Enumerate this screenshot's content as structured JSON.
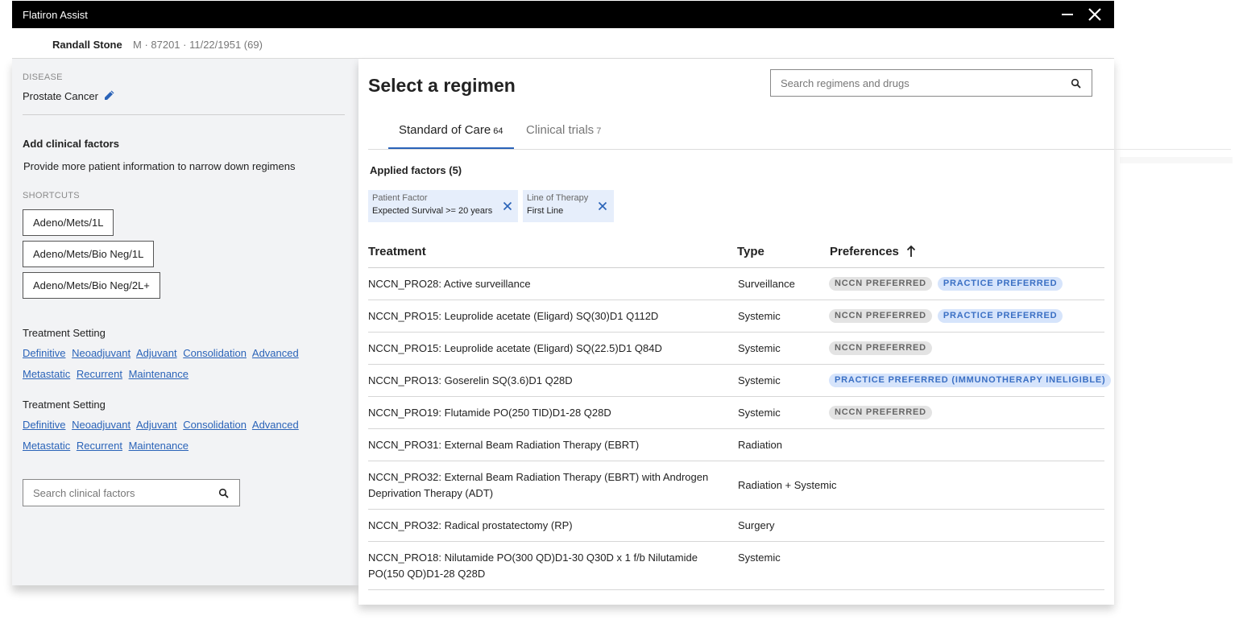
{
  "window": {
    "title": "Flatiron Assist"
  },
  "patient": {
    "name": "Randall Stone",
    "meta": "M · 87201 · 11/22/1951 (69)"
  },
  "left_panel": {
    "disease_label": "DISEASE",
    "disease_value": "Prostate Cancer",
    "add_factors_title": "Add clinical factors",
    "add_factors_desc": "Provide more patient information to narrow down regimens",
    "shortcuts_label": "SHORTCUTS",
    "shortcuts": [
      "Adeno/Mets/1L",
      "Adeno/Mets/Bio Neg/1L",
      "Adeno/Mets/Bio Neg/2L+"
    ],
    "treatment_settings": [
      {
        "title": "Treatment Setting",
        "links": [
          "Definitive",
          "Neoadjuvant",
          "Adjuvant",
          "Consolidation",
          "Advanced",
          "Metastatic",
          "Recurrent",
          "Maintenance"
        ]
      },
      {
        "title": "Treatment Setting",
        "links": [
          "Definitive",
          "Neoadjuvant",
          "Adjuvant",
          "Consolidation",
          "Advanced",
          "Metastatic",
          "Recurrent",
          "Maintenance"
        ]
      }
    ],
    "search_placeholder": "Search clinical factors"
  },
  "main": {
    "title": "Select a regimen",
    "search_placeholder": "Search regimens and drugs",
    "tabs": [
      {
        "label": "Standard of Care",
        "count": "64",
        "active": true
      },
      {
        "label": "Clinical trials",
        "count": "7",
        "active": false
      }
    ],
    "applied_title": "Applied factors (5)",
    "chips": [
      {
        "key": "Patient Factor",
        "value": "Expected Survival >= 20 years"
      },
      {
        "key": "Line of Therapy",
        "value": "First Line"
      }
    ],
    "table": {
      "headers": {
        "treatment": "Treatment",
        "type": "Type",
        "preferences": "Preferences"
      },
      "rows": [
        {
          "treatment": "NCCN_PRO28: Active surveillance",
          "type": "Surveillance",
          "prefs": [
            "NCCN PREFERRED",
            "PRACTICE PREFERRED"
          ]
        },
        {
          "treatment": "NCCN_PRO15: Leuprolide acetate (Eligard) SQ(30)D1 Q112D",
          "type": "Systemic",
          "prefs": [
            "NCCN PREFERRED",
            "PRACTICE PREFERRED"
          ]
        },
        {
          "treatment": "NCCN_PRO15: Leuprolide acetate (Eligard) SQ(22.5)D1 Q84D",
          "type": "Systemic",
          "prefs": [
            "NCCN PREFERRED"
          ]
        },
        {
          "treatment": "NCCN_PRO13: Goserelin SQ(3.6)D1 Q28D",
          "type": "Systemic",
          "prefs": [
            "PRACTICE PREFERRED (IMMUNOTHERAPY INELIGIBLE)"
          ]
        },
        {
          "treatment": "NCCN_PRO19: Flutamide PO(250 TID)D1-28 Q28D",
          "type": "Systemic",
          "prefs": [
            "NCCN PREFERRED"
          ]
        },
        {
          "treatment": "NCCN_PRO31: External Beam Radiation Therapy (EBRT)",
          "type": "Radiation",
          "prefs": []
        },
        {
          "treatment": "NCCN_PRO32: External Beam Radiation Therapy (EBRT) with Androgen Deprivation Therapy (ADT)",
          "type": "Radiation + Systemic",
          "prefs": []
        },
        {
          "treatment": "NCCN_PRO32: Radical prostatectomy (RP)",
          "type": "Surgery",
          "prefs": []
        },
        {
          "treatment": "NCCN_PRO18: Nilutamide PO(300 QD)D1-30 Q30D x 1 f/b Nilutamide PO(150 QD)D1-28 Q28D",
          "type": "Systemic",
          "prefs": []
        }
      ]
    }
  },
  "colors": {
    "accent": "#2a63b8",
    "titlebar": "#000000",
    "chip_bg": "#e6eefb",
    "practice_badge_bg": "#d6e4fb",
    "nccn_badge_bg": "#e3e3e3"
  },
  "icons": {
    "minimize": "minimize-icon",
    "close": "close-icon",
    "edit": "pencil-icon",
    "search": "search-icon",
    "sort": "arrow-up-icon",
    "chip_remove": "close-icon"
  }
}
